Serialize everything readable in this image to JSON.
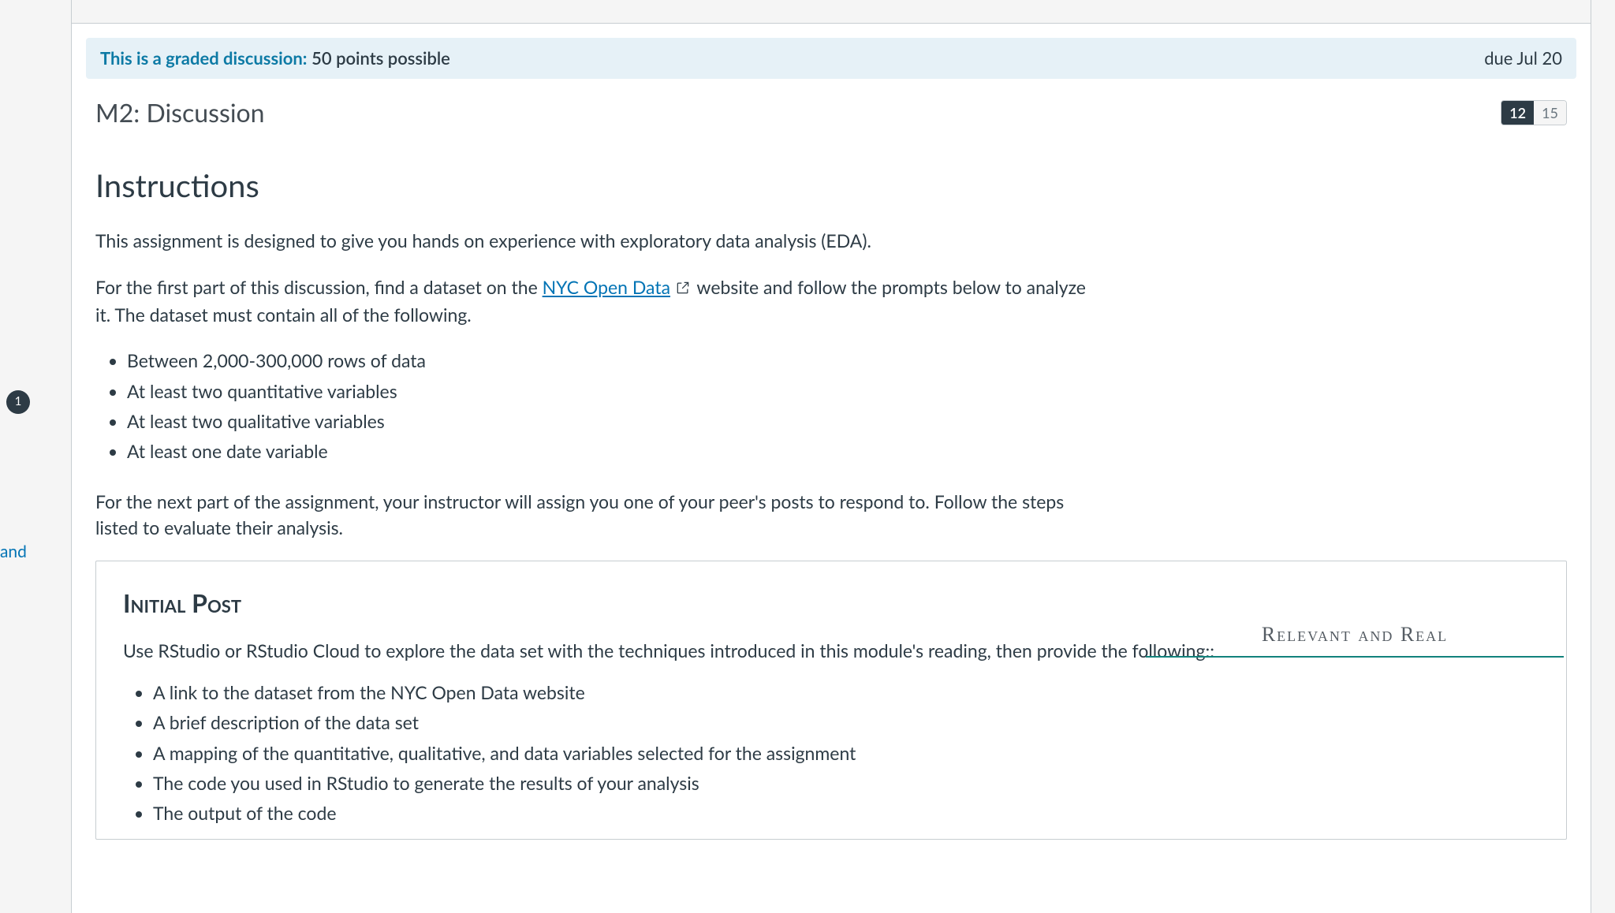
{
  "nav": {
    "badge": "1",
    "fragment": "and"
  },
  "graded_bar": {
    "prefix": "This is a graded discussion:",
    "points": "50 points possible",
    "due": "due Jul 20"
  },
  "discussion": {
    "title": "M2: Discussion",
    "unread": "12",
    "total": "15"
  },
  "instructions": {
    "heading": "Instructions",
    "p1": "This assignment is designed to give you hands on experience with exploratory data analysis (EDA).",
    "p2a": "For the first part of this discussion, find a dataset on the ",
    "link_text": "NYC Open Data",
    "p2b": " website and follow the prompts below to analyze it. The dataset must contain all of the following.",
    "requirements": [
      "Between 2,000-300,000 rows of data",
      "At least two quantitative variables",
      "At least two qualitative variables",
      "At least one date variable"
    ],
    "p3": "For the next part of the assignment, your instructor will assign you one of your peer's posts to respond to. Follow the steps listed to evaluate their analysis."
  },
  "side_heading": "Relevant and Real",
  "initial_post": {
    "heading": "Initial Post",
    "intro": "Use RStudio or RStudio Cloud to explore the data set with the techniques introduced in this module's reading, then provide the following::",
    "items": [
      "A link to the dataset from the NYC Open Data website",
      "A brief description of the data set",
      "A mapping of the quantitative, qualitative, and data variables selected for the assignment",
      "The code you used in RStudio to generate the results of your analysis",
      "The output of the code"
    ]
  }
}
